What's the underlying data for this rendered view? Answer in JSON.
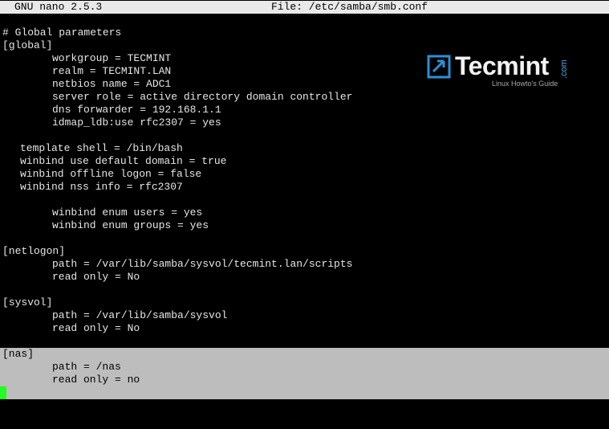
{
  "titlebar": {
    "app": "GNU nano 2.5.3",
    "file": "File: /etc/samba/smb.conf"
  },
  "logo": {
    "name": "Tecmint",
    "suffix": ".com",
    "tagline": "Linux Howto's Guide",
    "colors": {
      "icon": "#2a8fd6",
      "accent": "#4aa8e8"
    }
  },
  "editor": {
    "lines": [
      "# Global parameters",
      "[global]",
      "workgroup = TECMINT",
      "realm = TECMINT.LAN",
      "netbios name = ADC1",
      "server role = active directory domain controller",
      "dns forwarder = 192.168.1.1",
      "idmap_ldb:use rfc2307 = yes",
      "template shell = /bin/bash",
      "winbind use default domain = true",
      "winbind offline logon = false",
      "winbind nss info = rfc2307",
      "winbind enum users = yes",
      "winbind enum groups = yes",
      "[netlogon]",
      "path = /var/lib/samba/sysvol/tecmint.lan/scripts",
      "read only = No",
      "[sysvol]",
      "path = /var/lib/samba/sysvol",
      "read only = No",
      "[nas]",
      "path = /nas",
      "read only = no"
    ]
  },
  "colors": {
    "background": "#000000",
    "text": "#e6e6e6",
    "titlebar": "#e9e9e9",
    "selection": "#bdbdbd",
    "cursor": "#22ff22"
  }
}
